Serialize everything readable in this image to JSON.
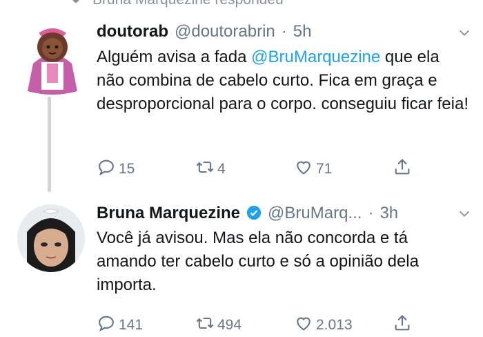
{
  "context": {
    "text": "Bruna Marquezine respondeu",
    "icon": "heart-icon"
  },
  "tweets": [
    {
      "name": "doutorab",
      "handle": "@doutorabrin",
      "separator": "·",
      "time": "5h",
      "text_before": "Alguém avisa a fada ",
      "mention": "@BruMarquezine",
      "text_after": " que ela não combina de cabelo curto. Fica em graça e desproporcional para o corpo. conseguiu ficar feia!",
      "replies": "15",
      "retweets": "4",
      "likes": "71"
    },
    {
      "name": "Bruna Marquezine",
      "verified": true,
      "handle": "@BruMarq...",
      "separator": "·",
      "time": "3h",
      "text": "Você já avisou.  Mas ela não concorda e tá amando ter cabelo curto e só a opinião dela importa.",
      "replies": "141",
      "retweets": "494",
      "likes": "2.013"
    }
  ],
  "colors": {
    "accent": "#1da1f2",
    "muted": "#657786",
    "thread_line": "#cfd4d8"
  }
}
